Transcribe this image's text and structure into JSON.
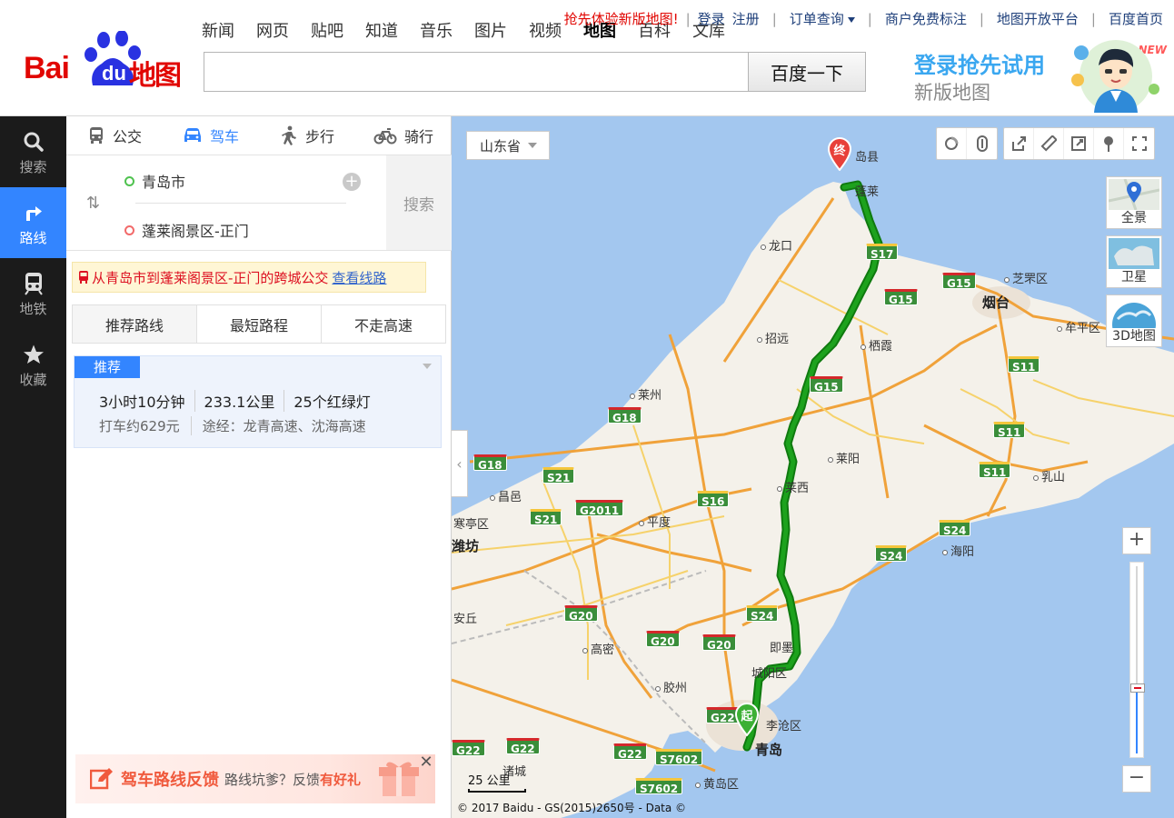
{
  "header": {
    "logo": {
      "bai": "Bai",
      "du": "du",
      "ditu": "地图"
    },
    "nav": [
      "新闻",
      "网页",
      "贴吧",
      "知道",
      "音乐",
      "图片",
      "视频",
      "地图",
      "百科",
      "文库"
    ],
    "nav_active": "地图",
    "links": {
      "promo": "抢先体验新版地图!",
      "login": "登录",
      "register": "注册",
      "orders": "订单查询",
      "merchant": "商户免费标注",
      "open_platform": "地图开放平台",
      "home": "百度首页"
    },
    "search": {
      "value": "",
      "placeholder": "",
      "button": "百度一下"
    },
    "banner": {
      "line1": "登录抢先试用",
      "line2": "新版地图",
      "badge": "NEW"
    }
  },
  "sidebar": {
    "items": [
      {
        "label": "搜索",
        "icon": "search-icon"
      },
      {
        "label": "路线",
        "icon": "route-icon"
      },
      {
        "label": "地铁",
        "icon": "subway-icon"
      },
      {
        "label": "收藏",
        "icon": "star-icon"
      }
    ],
    "active": "路线"
  },
  "route": {
    "modes": [
      {
        "label": "公交",
        "icon": "bus-icon"
      },
      {
        "label": "驾车",
        "icon": "car-icon"
      },
      {
        "label": "步行",
        "icon": "walk-icon"
      },
      {
        "label": "骑行",
        "icon": "bike-icon"
      }
    ],
    "active_mode": "驾车",
    "start": "青岛市",
    "end": "蓬莱阁景区-正门",
    "search_button": "搜索",
    "bus_note": {
      "text": "从青岛市到蓬莱阁景区-正门的跨城公交",
      "link": "查看线路"
    },
    "tabs": [
      "推荐路线",
      "最短路程",
      "不走高速"
    ],
    "active_tab": "推荐路线",
    "result": {
      "tag": "推荐",
      "duration": "3小时10分钟",
      "distance": "233.1公里",
      "lights": "25个红绿灯",
      "taxi": "打车约629元",
      "via": "途经：龙青高速、沈海高速"
    },
    "feedback": {
      "title": "驾车路线反馈",
      "sub_prefix": "路线坑爹？反馈",
      "sub_bold": "有好礼"
    }
  },
  "map": {
    "province": "山东省",
    "map_types": [
      "全景",
      "卫星",
      "3D地图"
    ],
    "zoom_in": "+",
    "zoom_out": "−",
    "zoom_level_fraction": 0.35,
    "scale": "25 公里",
    "copyright": "© 2017 Baidu - GS(2015)2650号 - Data ©",
    "start_pin": "起",
    "end_pin": "终",
    "labels": {
      "penglai_dao": "岛县",
      "penglai": "蓬莱",
      "longkou": "龙口",
      "zhifuqu": "芝罘区",
      "yantai": "烟台",
      "muping": "牟平区",
      "zhaoyuan": "招远",
      "qixia": "栖霞",
      "laizhou": "莱州",
      "laiyang": "莱阳",
      "laixi": "莱西",
      "rushan": "乳山",
      "changyi": "昌邑",
      "hantingqu": "寒亭区",
      "weifang": "潍坊",
      "pingdu": "平度",
      "haiyang": "海阳",
      "anqiu": "安丘",
      "gaomi": "高密",
      "jimo": "即墨",
      "chengyang": "城阳区",
      "jiaozhou": "胶州",
      "licang": "李沧区",
      "qingdao": "青岛",
      "zhucheng": "诸城",
      "huangdao": "黄岛区"
    },
    "shields": [
      "S17",
      "G15",
      "G15",
      "G15",
      "S11",
      "S11",
      "S11",
      "G18",
      "G18",
      "S21",
      "S21",
      "G2011",
      "S16",
      "S24",
      "S24",
      "G20",
      "G20",
      "G20",
      "S24",
      "G22",
      "G22",
      "G22",
      "G22",
      "S7602",
      "S7602"
    ]
  },
  "colors": {
    "accent": "#3385ff",
    "brand_red": "#e10602",
    "route": "#1da21d"
  }
}
